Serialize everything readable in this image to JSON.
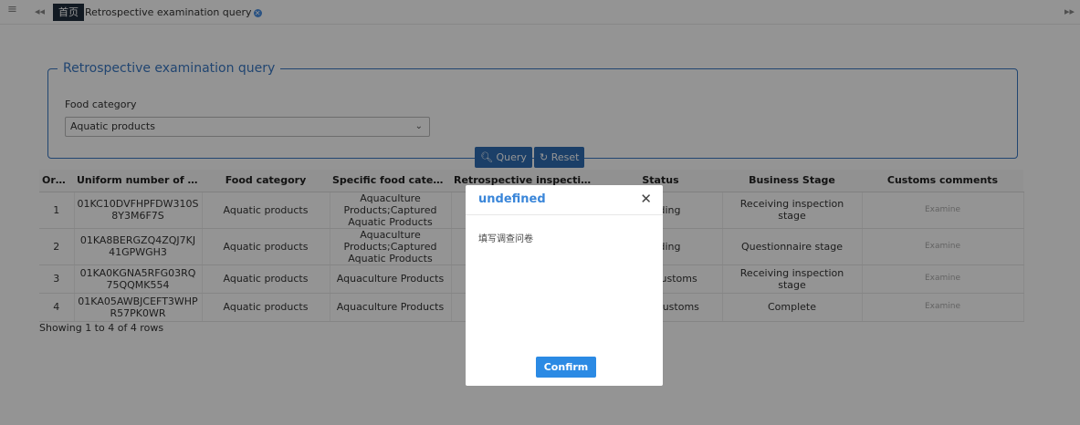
{
  "tabbar": {
    "menu_icon": "≡",
    "prev_icon": "◂◂",
    "home_tab": "首页",
    "active_tab": "Retrospective examination query",
    "next_icon": "▸▸"
  },
  "filter": {
    "legend": "Retrospective examination query",
    "food_category_label": "Food category",
    "food_category_value": "Aquatic products",
    "query_label": "Query",
    "reset_label": "Reset"
  },
  "table": {
    "headers": [
      "Orde...",
      "Uniform number of applic...",
      "Food category",
      "Specific food category",
      "Retrospective inspection ti...",
      "Status",
      "Business Stage",
      "Customs comments"
    ],
    "rows": [
      {
        "order": "1",
        "uniform": "01KC10DVFHPFDW310S8Y3M6F7S",
        "food": "Aquatic products",
        "specific": "Aquaculture Products;Captured Aquatic Products",
        "time": "",
        "status": "Pending",
        "stage": "Receiving inspection stage",
        "comments": "Examine"
      },
      {
        "order": "2",
        "uniform": "01KA8BERGZQ4ZQJ7KJ41GPWGH3",
        "food": "Aquatic products",
        "specific": "Aquaculture Products;Captured Aquatic Products",
        "time": "",
        "status": "Pending",
        "stage": "Questionnaire stage",
        "comments": "Examine"
      },
      {
        "order": "3",
        "uniform": "01KA0KGNA5RFG03RQ75QQMK554",
        "food": "Aquatic products",
        "specific": "Aquaculture Products",
        "time": "",
        "status": "ed by customs",
        "stage": "Receiving inspection stage",
        "comments": "Examine"
      },
      {
        "order": "4",
        "uniform": "01KA05AWBJCEFT3WHPR57PK0WR",
        "food": "Aquatic products",
        "specific": "Aquaculture Products",
        "time": "",
        "status": "by the customs",
        "stage": "Complete",
        "comments": "Examine"
      }
    ],
    "showing": "Showing 1 to 4 of 4 rows"
  },
  "modal": {
    "title": "undefined",
    "body": "填写调查问卷",
    "confirm_label": "Confirm",
    "close_icon": "✕"
  },
  "colors": {
    "accent": "#3a78c3",
    "button": "#2f6db3",
    "confirm": "#2b8ae4",
    "home_tab_bg": "#1f2d3d"
  }
}
